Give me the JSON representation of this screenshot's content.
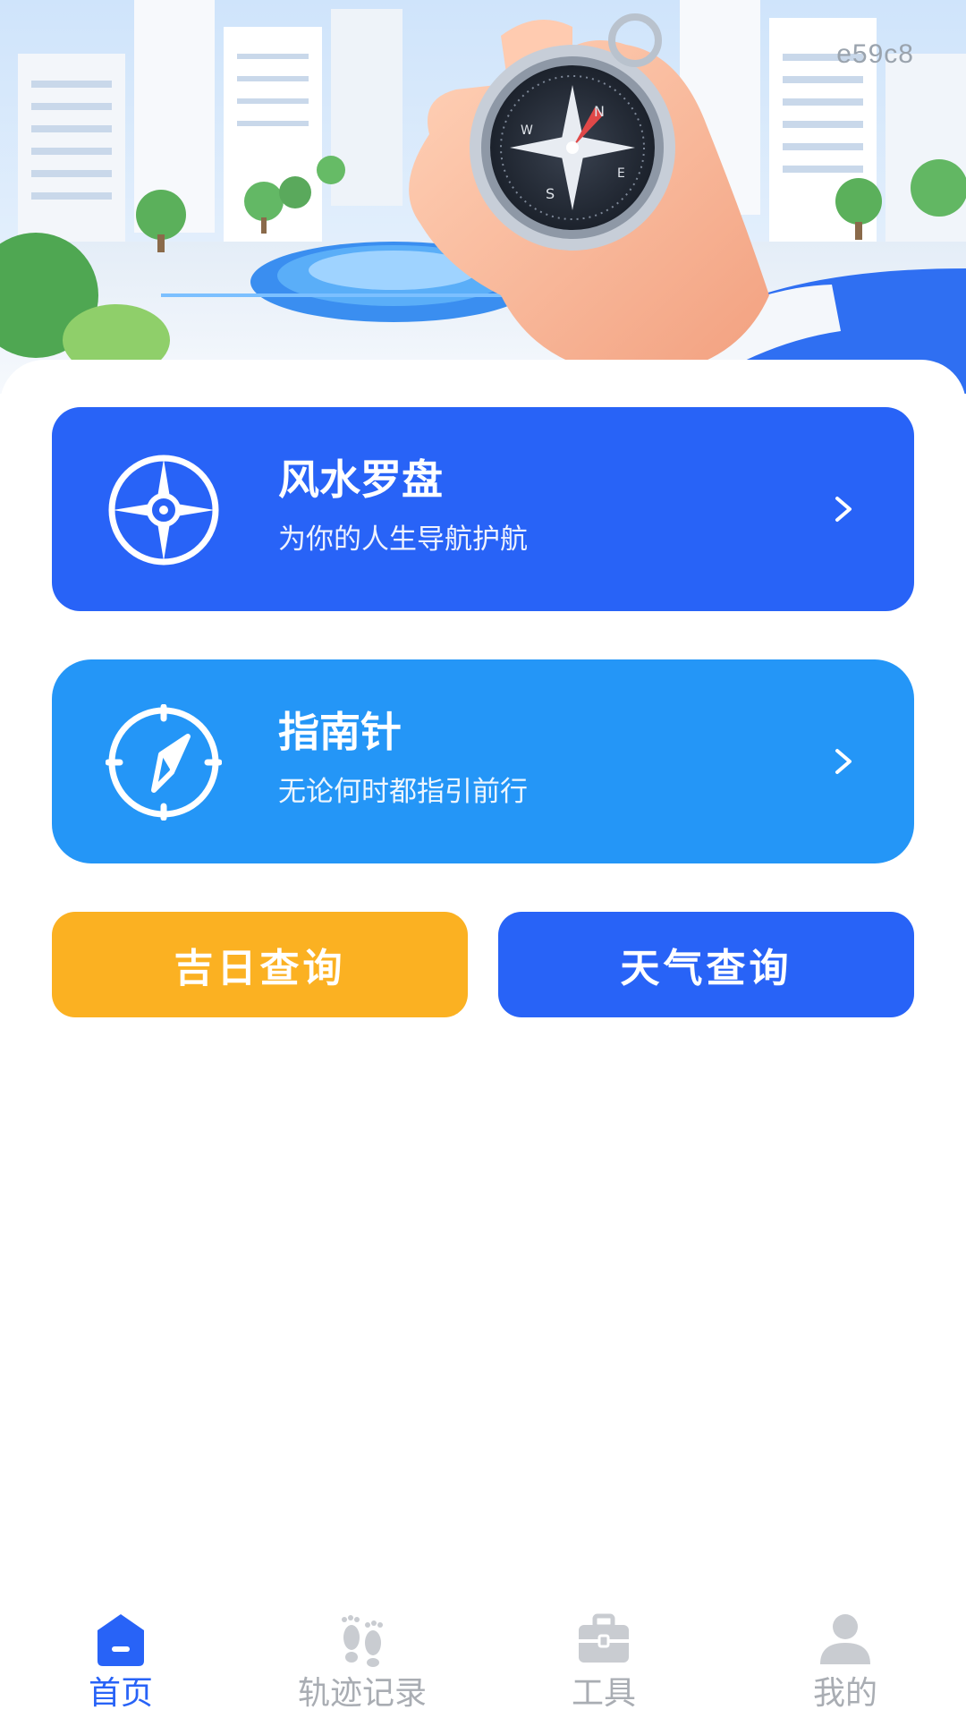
{
  "hero": {
    "code_label": "e59c8"
  },
  "cards": [
    {
      "title": "风水罗盘",
      "subtitle": "为你的人生导航护航"
    },
    {
      "title": "指南针",
      "subtitle": "无论何时都指引前行"
    }
  ],
  "buttons": {
    "auspicious_day": "吉日查询",
    "weather": "天气查询"
  },
  "tabbar": {
    "items": [
      {
        "label": "首页",
        "icon": "home-icon",
        "active": true
      },
      {
        "label": "轨迹记录",
        "icon": "footprints-icon",
        "active": false
      },
      {
        "label": "工具",
        "icon": "toolbox-icon",
        "active": false
      },
      {
        "label": "我的",
        "icon": "user-icon",
        "active": false
      }
    ]
  },
  "colors": {
    "primary": "#2863f7",
    "compass_card": "#2496f7",
    "accent_orange": "#fbb122",
    "tab_inactive": "#a9adb3"
  }
}
